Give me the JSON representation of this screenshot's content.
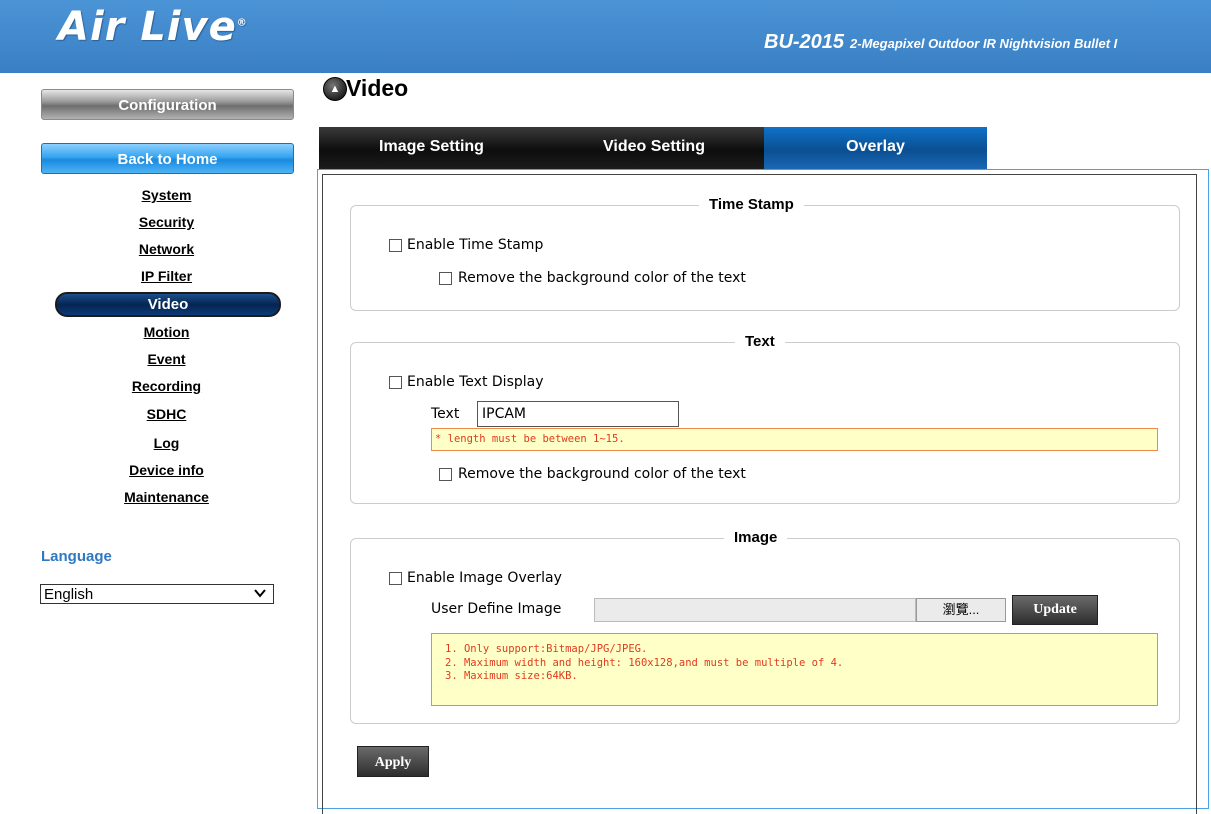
{
  "header": {
    "logo": "Air Live",
    "logo_mark": "®",
    "model": "BU-2015",
    "model_desc": "2-Megapixel Outdoor IR Nightvision Bullet I"
  },
  "sidebar": {
    "config_label": "Configuration",
    "home_label": "Back to Home",
    "items": [
      {
        "label": "System"
      },
      {
        "label": "Security"
      },
      {
        "label": "Network"
      },
      {
        "label": "IP Filter"
      },
      {
        "label": "Video",
        "active": true
      },
      {
        "label": "Motion"
      },
      {
        "label": "Event"
      },
      {
        "label": "Recording"
      },
      {
        "label": "SDHC"
      },
      {
        "label": "Log"
      },
      {
        "label": "Device info"
      },
      {
        "label": "Maintenance"
      }
    ],
    "language_title": "Language",
    "language_value": "English"
  },
  "main": {
    "title": "Video",
    "tabs": [
      {
        "label": "Image Setting"
      },
      {
        "label": "Video Setting"
      },
      {
        "label": "Overlay",
        "active": true
      }
    ]
  },
  "timestamp": {
    "legend": "Time Stamp",
    "enable_label": "Enable Time Stamp",
    "remove_bg_label": "Remove the background color of the text"
  },
  "text_section": {
    "legend": "Text",
    "enable_label": "Enable Text Display",
    "text_label": "Text",
    "text_value": "IPCAM",
    "length_note": "* length must be between 1~15.",
    "remove_bg_label": "Remove the background color of the text"
  },
  "image_section": {
    "legend": "Image",
    "enable_label": "Enable Image Overlay",
    "user_image_label": "User Define Image",
    "browse_label": "瀏覽...",
    "update_label": "Update",
    "notes": [
      "1. Only support:Bitmap/JPG/JPEG.",
      "2. Maximum width and height: 160x128,and must be multiple of 4.",
      "3. Maximum size:64KB."
    ]
  },
  "apply_label": "Apply",
  "colors": {
    "header_blue": "#3a7fc4",
    "active_tab": "#0b4f92",
    "language_title": "#2f79c2",
    "warning_text": "#e03b1f",
    "warning_bg": "#ffffc8"
  }
}
